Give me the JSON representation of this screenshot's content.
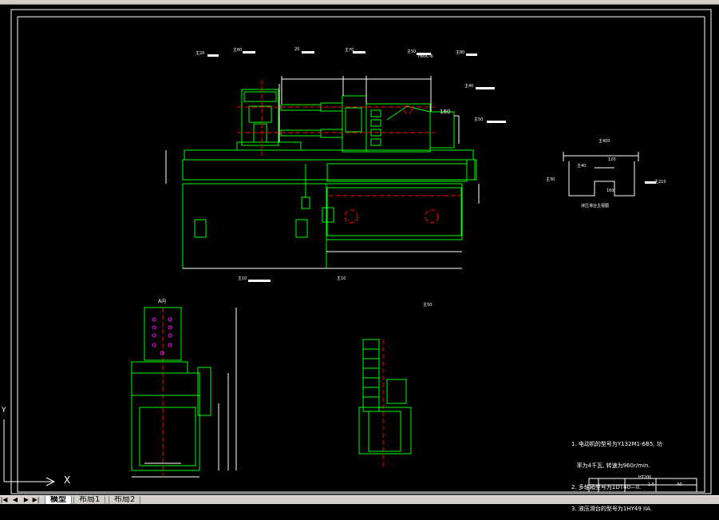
{
  "app": {
    "window_controls": ""
  },
  "drawing": {
    "labels": {
      "top_left_1": "主20",
      "top_left_2": "主60",
      "top_mid_1": "20",
      "top_mid_2": "主70",
      "top_mid_3": "主50",
      "top_mid_4": "H80C-6",
      "top_right_1": "主80",
      "top_right_2": "主40",
      "top_right_3": "主50",
      "dim_160": "160",
      "bottom_mid_1": "主10",
      "bottom_mid_2": "主10",
      "bottom_right_label": "主50",
      "section_title": "A向",
      "side_label_1": "主400",
      "side_label_2": "主30",
      "side_label_3": "主40",
      "side_label_4": "120",
      "side_label_5": "主210",
      "side_label_6": "160",
      "side_caption": "液压滑台主视图"
    },
    "notes": [
      "1. 电动机的型号为Y132M1-6B5, 功",
      "   率为4千瓦, 转速为960r/min.",
      "2. 多轴箱型号为1DT40—II.",
      "3. 液压滑台的型号为1HY49 IIA."
    ],
    "title_block": {
      "code": "HT200",
      "scale": "1:5",
      "size": "A0"
    }
  },
  "ucs": {
    "y_axis": "Y",
    "x_axis": "X"
  },
  "layout_tabs": {
    "nav": [
      "|◀",
      "◀",
      "▶",
      "▶|"
    ],
    "items": [
      "模型",
      "布局1",
      "布局2"
    ],
    "active": 0
  },
  "colors": {
    "background": "#000000",
    "green": "#00ff00",
    "white": "#ffffff",
    "red": "#ff0000",
    "magenta": "#ff00ff",
    "cyan": "#00ffff",
    "yellow": "#ffff00",
    "tabbar": "#d4d0c8"
  }
}
